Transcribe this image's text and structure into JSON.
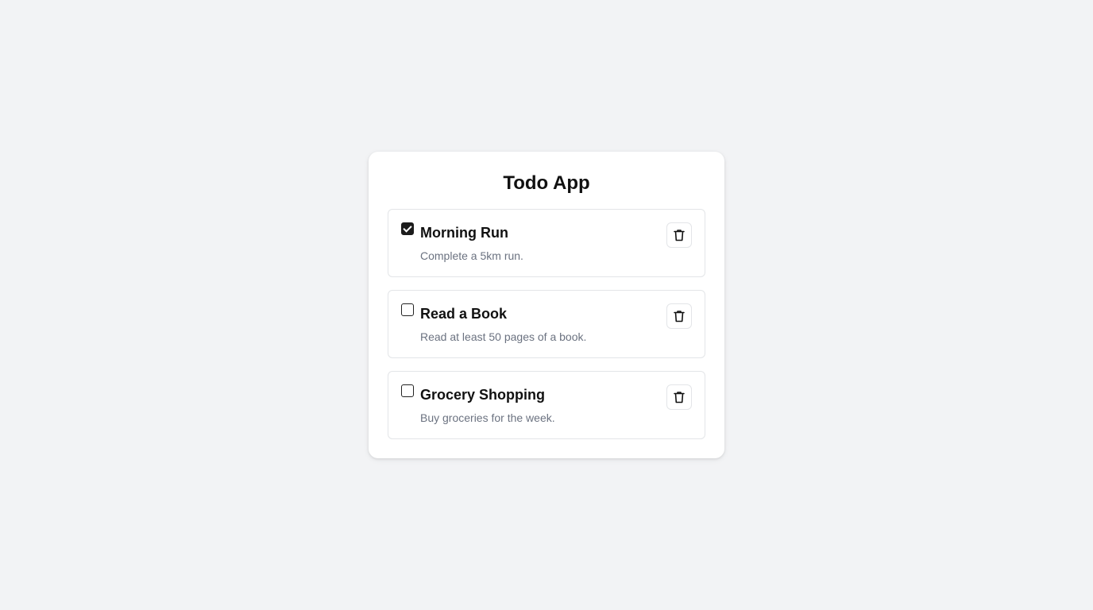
{
  "app": {
    "title": "Todo App"
  },
  "todos": [
    {
      "title": "Morning Run",
      "description": "Complete a 5km run.",
      "completed": true,
      "delete_icon": "trash-icon"
    },
    {
      "title": "Read a Book",
      "description": "Read at least 50 pages of a book.",
      "completed": false,
      "delete_icon": "trash-icon"
    },
    {
      "title": "Grocery Shopping",
      "description": "Buy groceries for the week.",
      "completed": false,
      "delete_icon": "trash-icon"
    }
  ],
  "colors": {
    "background": "#f2f3f5",
    "card": "#ffffff",
    "text_primary": "#111111",
    "text_secondary": "#6b7280",
    "border": "#e3e5e8",
    "checkbox_checked": "#1c1c1c"
  }
}
